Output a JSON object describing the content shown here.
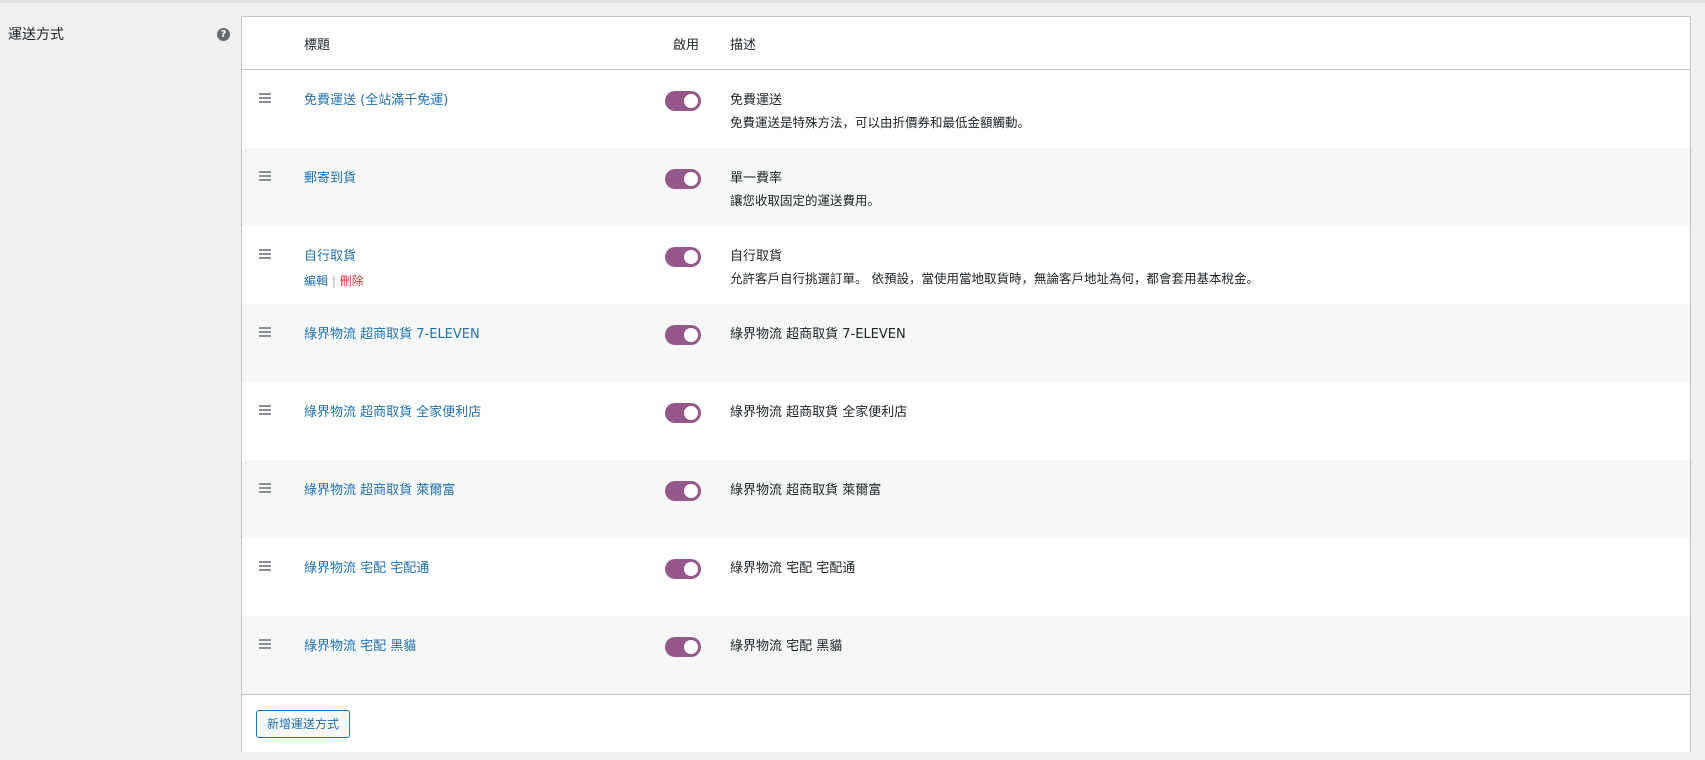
{
  "section": {
    "label": "運送方式",
    "help_icon": "?"
  },
  "table": {
    "headers": {
      "title": "標題",
      "enabled": "啟用",
      "description": "描述"
    },
    "rows": [
      {
        "title": "免費運送 (全站滿千免運)",
        "enabled": true,
        "desc_title": "免費運送",
        "desc_text": "免費運送是特殊方法，可以由折價券和最低金額觸動。"
      },
      {
        "title": "郵寄到貨",
        "enabled": true,
        "desc_title": "單一費率",
        "desc_text": "讓您收取固定的運送費用。"
      },
      {
        "title": "自行取貨",
        "enabled": true,
        "desc_title": "自行取貨",
        "desc_text": "允許客戶自行挑選訂單。 依預設，當使用當地取貨時，無論客戶地址為何，都會套用基本稅金。",
        "actions": {
          "edit": "編輯",
          "separator": "|",
          "delete": "刪除"
        }
      },
      {
        "title": "綠界物流 超商取貨 7-ELEVEN",
        "enabled": true,
        "desc_title": "綠界物流 超商取貨 7-ELEVEN",
        "desc_text": ""
      },
      {
        "title": "綠界物流 超商取貨 全家便利店",
        "enabled": true,
        "desc_title": "綠界物流 超商取貨 全家便利店",
        "desc_text": ""
      },
      {
        "title": "綠界物流 超商取貨 萊爾富",
        "enabled": true,
        "desc_title": "綠界物流 超商取貨 萊爾富",
        "desc_text": ""
      },
      {
        "title": "綠界物流 宅配 宅配通",
        "enabled": true,
        "desc_title": "綠界物流 宅配 宅配通",
        "desc_text": ""
      },
      {
        "title": "綠界物流 宅配 黑貓",
        "enabled": true,
        "desc_title": "綠界物流 宅配 黑貓",
        "desc_text": ""
      }
    ]
  },
  "footer": {
    "add_button_label": "新增運送方式"
  },
  "colors": {
    "toggle_on": "#96588a",
    "link": "#2271b1",
    "delete": "#d63638"
  }
}
